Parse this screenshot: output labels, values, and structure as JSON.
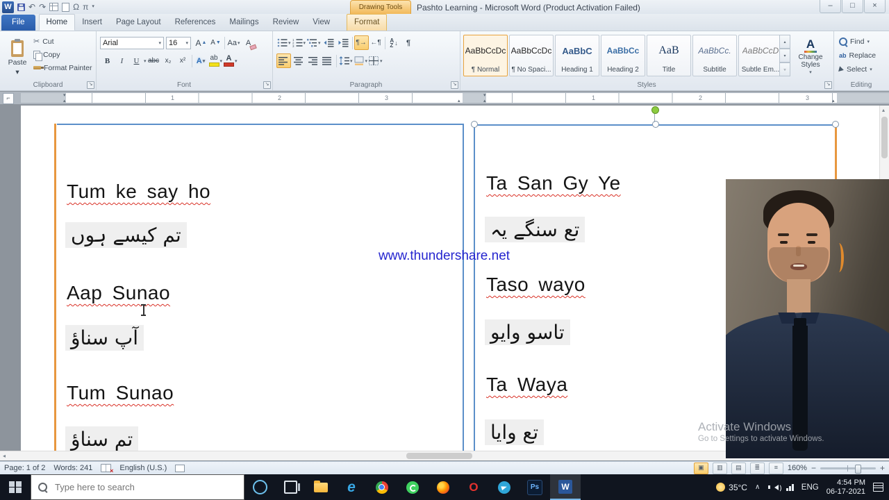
{
  "window": {
    "title": "Pashto Learning  -  Microsoft Word (Product Activation Failed)",
    "contextual_group": "Drawing Tools"
  },
  "quick_access": {
    "app_initial": "W"
  },
  "icons": {
    "dropdown": "▾",
    "undo": "↶",
    "redo": "↷",
    "omega": "Ω",
    "pi": "π",
    "pilcrow": "¶",
    "scissors": "✂",
    "minimize": "–",
    "maximize": "□",
    "close": "×",
    "chevron_up": "∧",
    "scroll_left": "◂",
    "scroll_right": "▸",
    "scroll_up": "▴",
    "scroll_down": "▾"
  },
  "tabs": {
    "file": "File",
    "home": "Home",
    "insert": "Insert",
    "page_layout": "Page Layout",
    "references": "References",
    "mailings": "Mailings",
    "review": "Review",
    "view": "View",
    "format": "Format"
  },
  "ribbon": {
    "clipboard": {
      "label": "Clipboard",
      "paste": "Paste",
      "cut": "Cut",
      "copy": "Copy",
      "format_painter": "Format Painter"
    },
    "font": {
      "label": "Font",
      "family": "Arial",
      "size": "16",
      "bold": "B",
      "italic": "I",
      "underline": "U",
      "strike": "abc",
      "subscript": "x₂",
      "superscript": "x²",
      "case_toggle": "Aa",
      "effects": "A",
      "highlight": "ab",
      "font_color": "A"
    },
    "paragraph": {
      "label": "Paragraph",
      "sort_a": "A",
      "sort_z": "Z",
      "sort_arrow": "↓"
    },
    "styles": {
      "label": "Styles",
      "items": [
        {
          "preview": "AaBbCcDc",
          "name": "¶ Normal"
        },
        {
          "preview": "AaBbCcDc",
          "name": "¶ No Spaci..."
        },
        {
          "preview": "AaBbC",
          "name": "Heading 1"
        },
        {
          "preview": "AaBbCc",
          "name": "Heading 2"
        },
        {
          "preview": "AaB",
          "name": "Title"
        },
        {
          "preview": "AaBbCc.",
          "name": "Subtitle"
        },
        {
          "preview": "AaBbCcD",
          "name": "Subtle Em..."
        }
      ],
      "change_styles": "Change Styles"
    },
    "editing": {
      "label": "Editing",
      "find": "Find",
      "replace": "Replace",
      "select": "Select"
    }
  },
  "ruler": {
    "left_numbers": [
      "1",
      "2",
      "3"
    ],
    "right_numbers": [
      "1",
      "2",
      "3"
    ]
  },
  "document": {
    "watermark": "www.thundershare.net",
    "left_column": [
      {
        "latin": "Tum ke say ho",
        "urdu": "تم کیسے ہوں"
      },
      {
        "latin": "Aap Sunao",
        "urdu": "آپ سناؤ"
      },
      {
        "latin": "Tum Sunao",
        "urdu": "تم سناؤ"
      }
    ],
    "right_column": [
      {
        "latin": "Ta San Gy Ye",
        "urdu": "تع سنگے یہ"
      },
      {
        "latin": "Taso wayo",
        "urdu": "تاسو وایو"
      },
      {
        "latin": "Ta Waya",
        "urdu": "تع وایا"
      }
    ]
  },
  "activation": {
    "line1": "Activate Windows",
    "line2": "Go to Settings to activate Windows."
  },
  "status_bar": {
    "page": "Page: 1 of 2",
    "words": "Words: 241",
    "language": "English (U.S.)",
    "zoom": "160%",
    "zoom_out": "−",
    "zoom_in": "+"
  },
  "taskbar": {
    "search_placeholder": "Type here to search",
    "tray": {
      "temperature": "35°C",
      "language": "ENG",
      "time": "4:54 PM",
      "date": "06-17-2021"
    }
  }
}
